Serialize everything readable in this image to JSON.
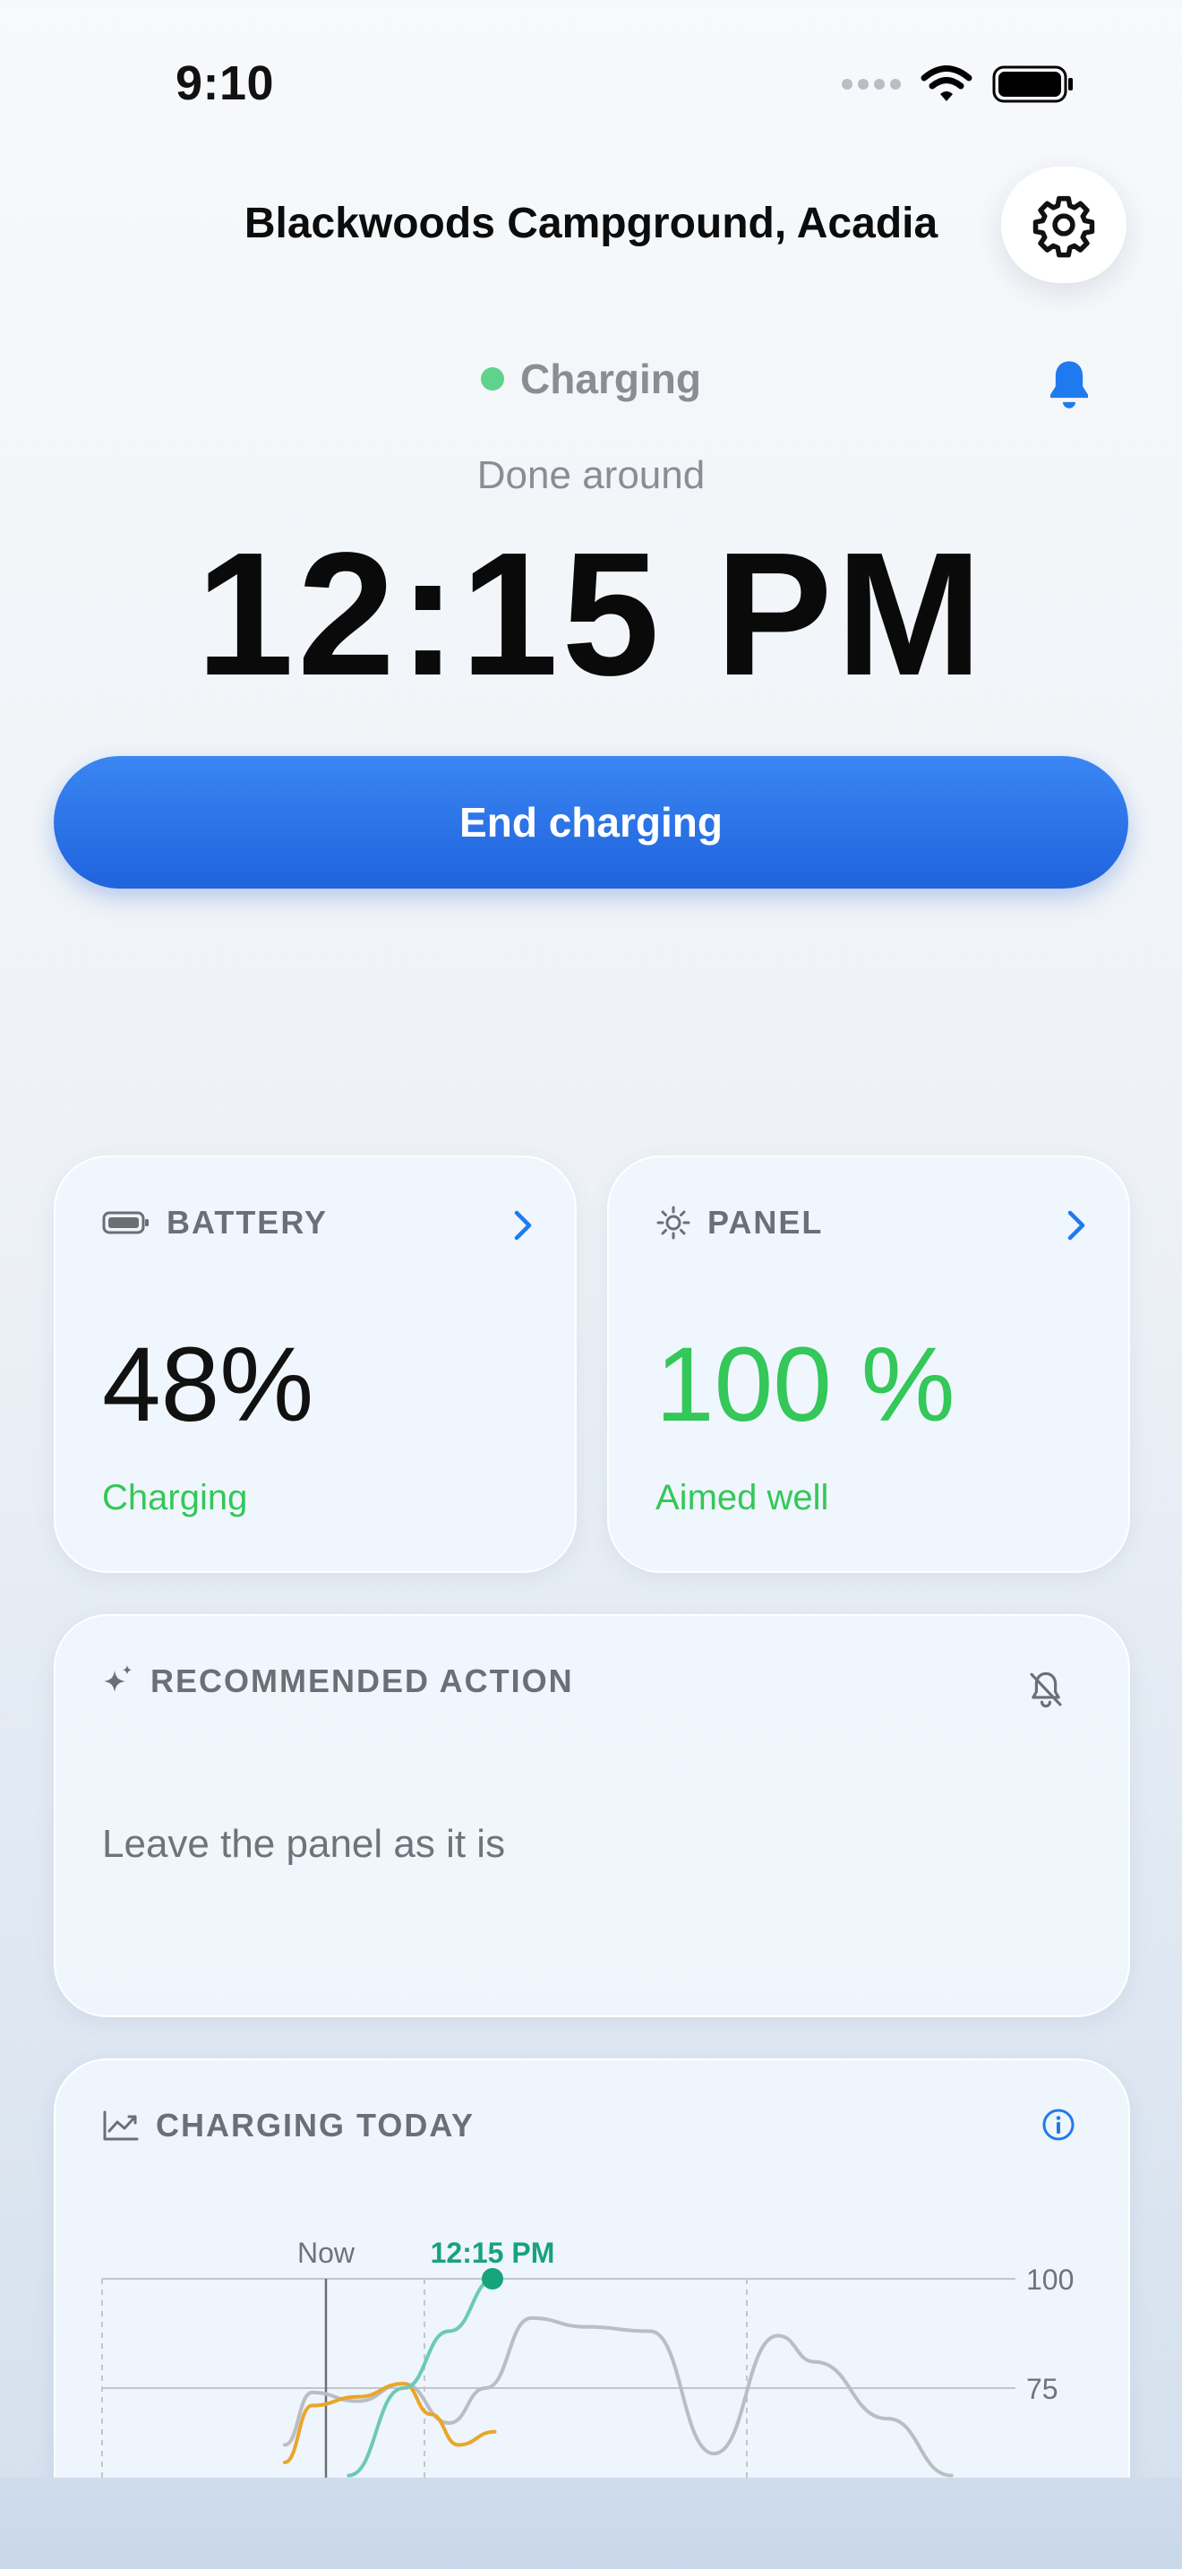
{
  "status_bar": {
    "time": "9:10"
  },
  "header": {
    "title": "Blackwoods Campground, Acadia"
  },
  "charging": {
    "status": "Charging",
    "done_label": "Done around",
    "done_time": "12:15 PM",
    "end_button": "End charging"
  },
  "battery": {
    "title": "BATTERY",
    "value": "48%",
    "sub": "Charging"
  },
  "panel": {
    "title": "PANEL",
    "value": "100 %",
    "sub": "Aimed well"
  },
  "recommendation": {
    "title": "RECOMMENDED ACTION",
    "text": "Leave the panel as it is"
  },
  "chart": {
    "title": "CHARGING TODAY",
    "now_label": "Now",
    "done_label": "12:15 PM",
    "y_ticks": [
      "100",
      "75"
    ]
  },
  "chart_data": {
    "type": "line",
    "title": "CHARGING TODAY",
    "y_ticks": [
      100,
      75
    ],
    "markers": [
      {
        "label": "Now"
      },
      {
        "label": "12:15 PM"
      }
    ],
    "series": [
      {
        "color": "#b9bdc4",
        "x": [
          0.2,
          0.23,
          0.28,
          0.33,
          0.38,
          0.42,
          0.47,
          0.53,
          0.6,
          0.67,
          0.74,
          0.78,
          0.86,
          0.93
        ],
        "y": [
          62,
          74,
          72,
          76,
          67,
          75,
          91,
          89,
          88,
          60,
          87,
          81,
          68,
          55
        ]
      },
      {
        "color": "#e9a628",
        "x": [
          0.2,
          0.23,
          0.28,
          0.33,
          0.36,
          0.39,
          0.43
        ],
        "y": [
          58,
          71,
          73,
          76,
          69,
          62,
          65
        ]
      },
      {
        "color": "#6cc9b4",
        "x": [
          0.27,
          0.33,
          0.38,
          0.43
        ],
        "y": [
          55,
          75,
          88,
          100
        ]
      }
    ],
    "colors": {
      "accent": "#1f63dd",
      "positive": "#34c759",
      "done_marker": "#17a37b"
    }
  }
}
